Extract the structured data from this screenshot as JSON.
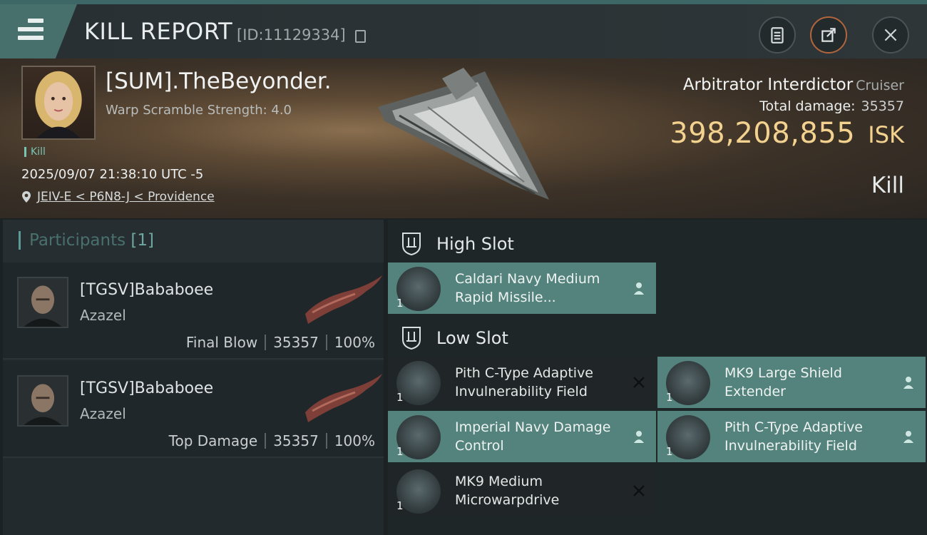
{
  "header": {
    "title": "KILL REPORT",
    "report_id": "[ID:11129334]",
    "menu_icon": "hamburger-icon",
    "actions": [
      "clipboard-icon",
      "share-icon",
      "close-icon"
    ]
  },
  "victim": {
    "name": "[SUM].TheBeyonder.",
    "warp_scramble": "Warp Scramble Strength: 4.0",
    "tag": "Kill",
    "datetime": "2025/09/07 21:38:10 UTC -5",
    "location": "JEIV-E < P6N8-J < Providence",
    "ship_name": "Arbitrator Interdictor",
    "ship_class": "Cruiser",
    "total_damage_label": "Total damage:",
    "total_damage": "35357",
    "isk_value": "398,208,855",
    "isk_unit": "ISK",
    "result": "Kill"
  },
  "participants": {
    "title": "Participants",
    "count": "[1]",
    "rows": [
      {
        "name": "[TGSV]Bababoee",
        "ship": "Azazel",
        "role": "Final Blow",
        "damage": "35357",
        "percent": "100%"
      },
      {
        "name": "[TGSV]Bababoee",
        "ship": "Azazel",
        "role": "Top Damage",
        "damage": "35357",
        "percent": "100%"
      }
    ]
  },
  "fittings": {
    "high_slot": {
      "label": "High Slot",
      "modules": [
        {
          "name": "Caldari Navy Medium Rapid Missile...",
          "qty": "1",
          "state": "dropped"
        }
      ]
    },
    "low_slot": {
      "label": "Low Slot",
      "modules": [
        {
          "name": "Pith C-Type Adaptive Invulnerability Field",
          "qty": "1",
          "state": "destroyed"
        },
        {
          "name": "MK9 Large Shield Extender",
          "qty": "1",
          "state": "dropped"
        },
        {
          "name": "Imperial Navy Damage Control",
          "qty": "1",
          "state": "dropped"
        },
        {
          "name": "Pith C-Type Adaptive Invulnerability Field",
          "qty": "1",
          "state": "dropped"
        },
        {
          "name": "MK9 Medium Microwarpdrive",
          "qty": "1",
          "state": "destroyed"
        }
      ]
    }
  },
  "colors": {
    "accent_teal": "#53837c",
    "isk_gold": "#f3d28f",
    "share_ring": "#b1653c"
  }
}
